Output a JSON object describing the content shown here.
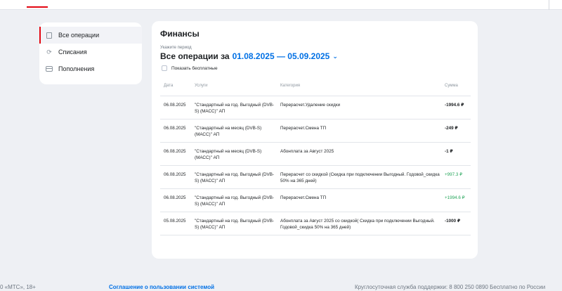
{
  "sidebar": {
    "items": [
      {
        "label": "Все операции",
        "icon": "document-icon"
      },
      {
        "label": "Списания",
        "icon": "refresh-icon"
      },
      {
        "label": "Пополнения",
        "icon": "card-icon"
      }
    ]
  },
  "main": {
    "title": "Финансы",
    "period_hint": "Укажите период",
    "period_prefix": "Все операции за",
    "period_range": "01.08.2025 — 05.09.2025",
    "show_free_label": "Показать бесплатные",
    "columns": [
      "Дата",
      "Услуги",
      "Категория",
      "Сумма"
    ],
    "rows": [
      {
        "date": "06.08.2025",
        "service": "\"Стандартный на год. Выгодный (DVB-S) (МАСС)\" АП",
        "category": "Перерасчет.Удаление скидки",
        "sum": "-1994.6 ₽"
      },
      {
        "date": "06.08.2025",
        "service": "\"Стандартный на месяц (DVB-S) (МАСС)\" АП",
        "category": "Перерасчет.Смена ТП",
        "sum": "-249 ₽"
      },
      {
        "date": "06.08.2025",
        "service": "\"Стандартный на месяц (DVB-S) (МАСС)\" АП",
        "category": "Абонплата за Август 2025",
        "sum": "-1 ₽"
      },
      {
        "date": "06.08.2025",
        "service": "\"Стандартный на год. Выгодный (DVB-S) (МАСС)\" АП",
        "category": "Перерасчет со скидкой (Скидка при подключении Выгодный. Годовой_скидка 50% на 365 дней)",
        "sum": "+997.3 ₽"
      },
      {
        "date": "06.08.2025",
        "service": "\"Стандартный на год. Выгодный (DVB-S) (МАСС)\" АП",
        "category": "Перерасчет.Смена ТП",
        "sum": "+1994.6 ₽"
      },
      {
        "date": "05.08.2025",
        "service": "\"Стандартный на год. Выгодный (DVB-S) (МАСС)\" АП",
        "category": "Абонплата за Август 2025 со скидкой( Скидка при подключении Выгодный. Годовой_скидка 50% на 365 дней)",
        "sum": "-1000 ₽"
      }
    ]
  },
  "footer": {
    "copyright": "0 «МТС», 18+",
    "agreement": "Соглашение о пользовании системой",
    "support": "Круглосуточная служба поддержки: 8 800 250 0890 Бесплатно по России"
  },
  "colors": {
    "accent": "#e30611",
    "link": "#0070e5",
    "positive": "#26a65b"
  }
}
